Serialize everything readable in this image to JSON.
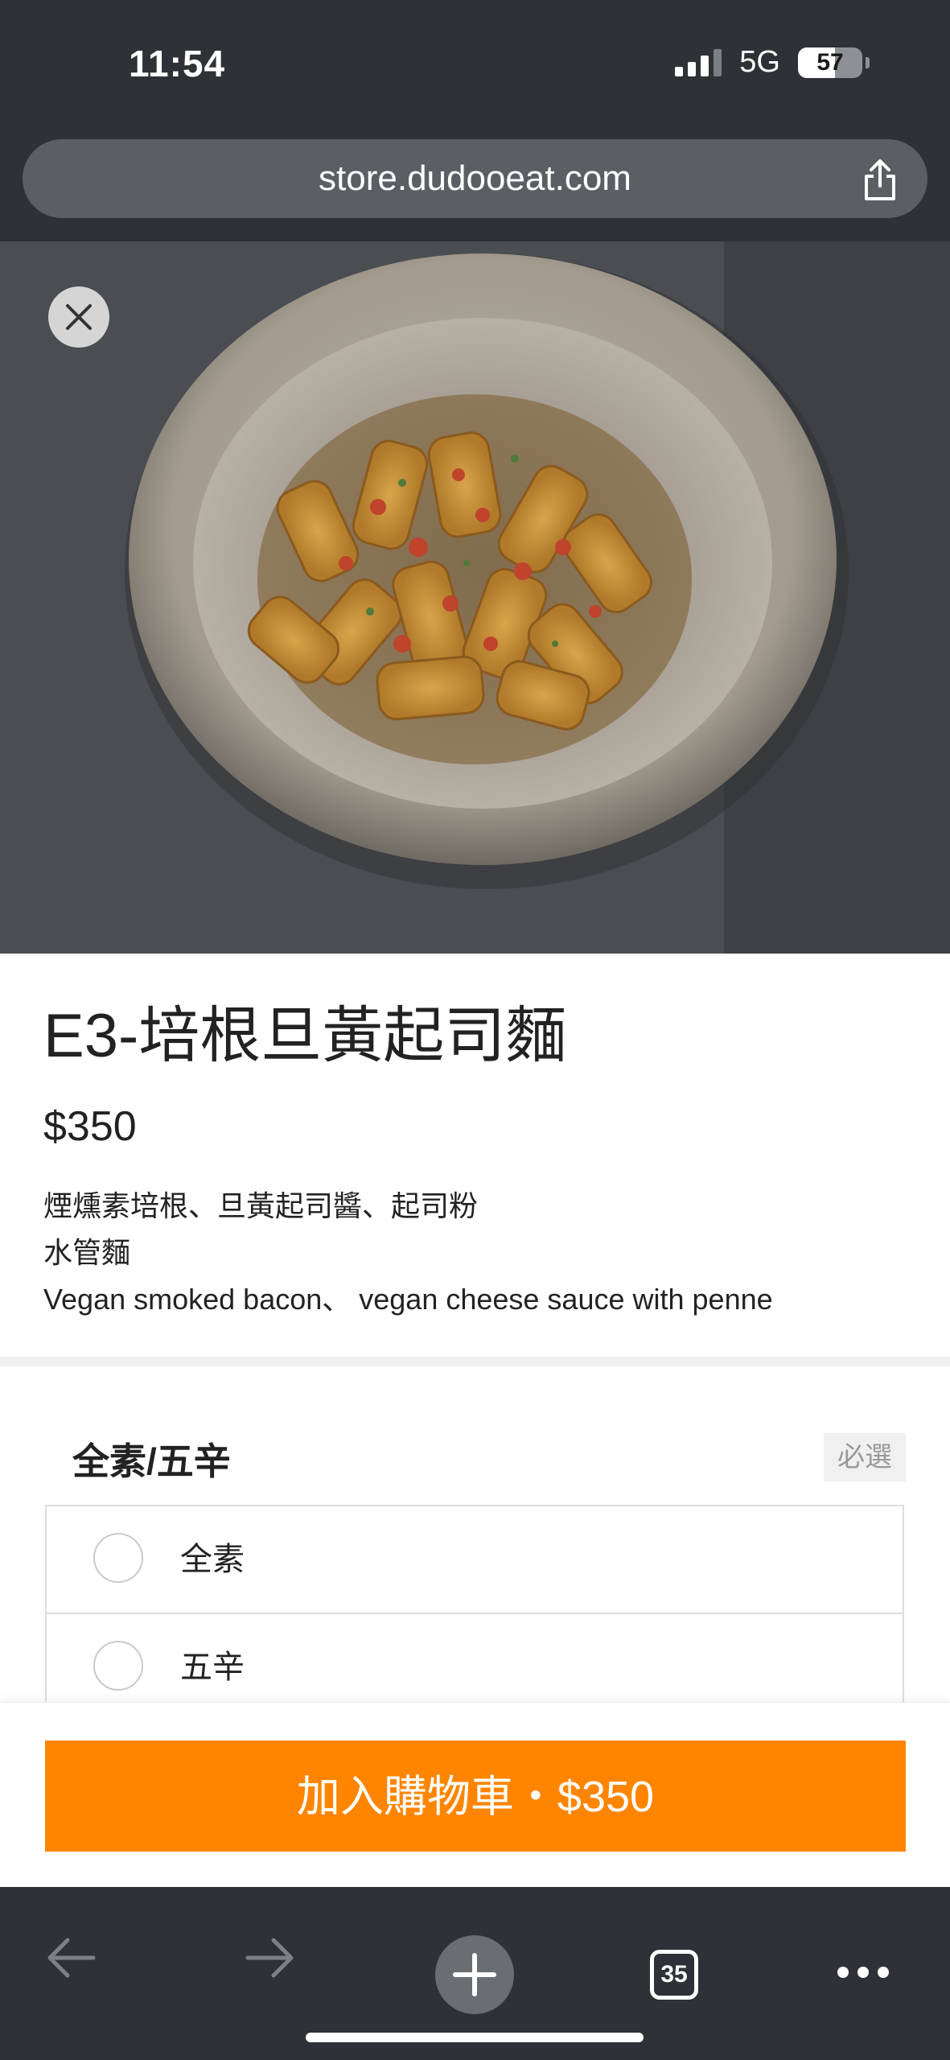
{
  "status_bar": {
    "time": "11:54",
    "network": "5G",
    "battery_percent": "57",
    "signal_bars": 3
  },
  "browser": {
    "url": "store.dudooeat.com",
    "tab_count": "35"
  },
  "product": {
    "title": "E3-培根旦黃起司麵",
    "price": "$350",
    "description_lines": [
      "煙燻素培根、旦黃起司醬、起司粉",
      "水管麵",
      "Vegan smoked bacon、 vegan cheese sauce with penne"
    ]
  },
  "options": {
    "group_title": "全素/五辛",
    "required_label": "必選",
    "items": [
      {
        "label": "全素",
        "selected": false
      },
      {
        "label": "五辛",
        "selected": false
      }
    ]
  },
  "cart": {
    "button_label": "加入購物車‧$350"
  },
  "colors": {
    "accent": "#ff8500",
    "chrome": "#2e3135",
    "address_bar": "#5b5f64"
  },
  "icons": [
    "share-icon",
    "close-icon",
    "back-arrow-icon",
    "forward-arrow-icon",
    "new-tab-plus-icon",
    "tabs-icon",
    "more-icon"
  ]
}
